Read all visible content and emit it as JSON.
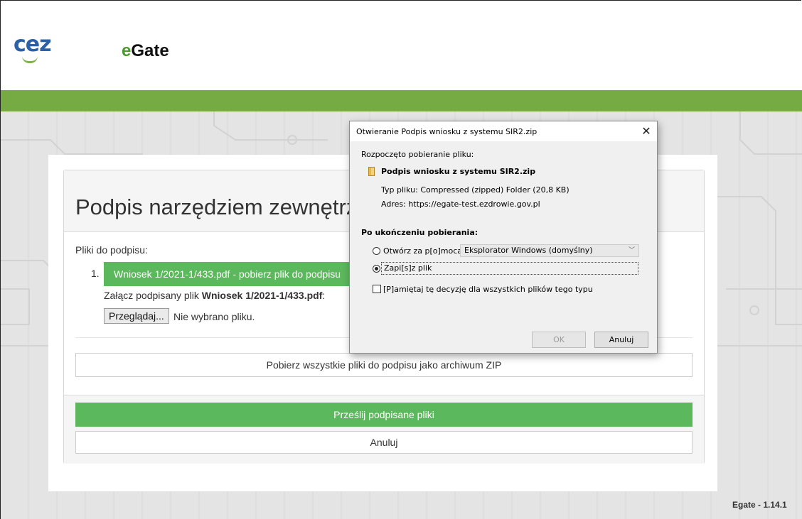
{
  "header": {
    "logo_text": "cez",
    "app_title_prefix": "e",
    "app_title_rest": "Gate"
  },
  "panel": {
    "title": "Podpis narzędziem zewnętrz",
    "files_label": "Pliki do podpisu:",
    "file_number": "1.",
    "file_link": "Wniosek 1/2021-1/433.pdf - pobierz plik do podpisu",
    "attach_prefix": "Załącz podpisany plik ",
    "attach_file": "Wniosek 1/2021-1/433.pdf",
    "attach_suffix": ":",
    "browse_label": "Przeglądaj...",
    "no_file_label": "Nie wybrano pliku.",
    "zip_button": "Pobierz wszystkie pliki do podpisu jako archiwum ZIP",
    "send_button": "Prześlij podpisane pliki",
    "cancel_button": "Anuluj"
  },
  "footer": {
    "version": "Egate - 1.14.1"
  },
  "dialog": {
    "title": "Otwieranie Podpis wniosku z systemu SIR2.zip",
    "close_glyph": "✕",
    "started_label": "Rozpoczęto pobieranie pliku:",
    "file_name": "Podpis wniosku z systemu SIR2.zip",
    "type_label": "Typ pliku:",
    "type_value": "Compressed (zipped) Folder (20,8 KB)",
    "address_label": "Adres:",
    "address_value": "https://egate-test.ezdrowie.gov.pl",
    "after_label": "Po ukończeniu pobierania:",
    "open_with_label": "Otwórz za p[o]mocą",
    "open_with_selected": "Eksplorator Windows (domyślny)",
    "open_with_selected_state": false,
    "save_label": "Zapi[s]z plik",
    "save_selected_state": true,
    "remember_label": "[P]amiętaj tę decyzję dla wszystkich plików tego typu",
    "remember_checked": false,
    "ok_button": "OK",
    "cancel_button": "Anuluj"
  },
  "colors": {
    "brand_green": "#76aa42",
    "button_green": "#5cb85c",
    "logo_blue": "#2c61a8"
  }
}
